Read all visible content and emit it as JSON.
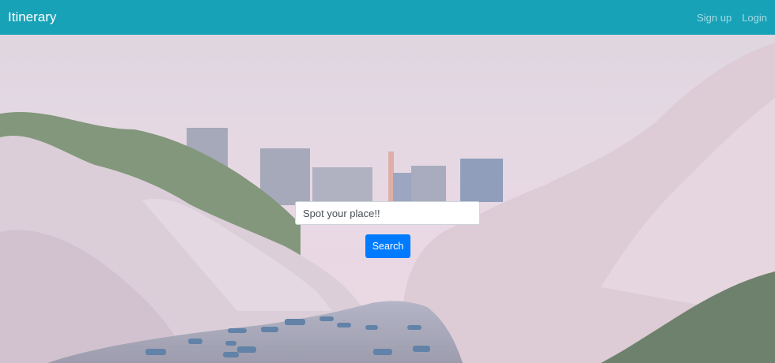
{
  "navbar": {
    "brand": "Itinerary",
    "links": [
      {
        "label": "Sign up"
      },
      {
        "label": "Login"
      }
    ]
  },
  "search": {
    "value": "Spot your place!!",
    "button_label": "Search"
  },
  "colors": {
    "navbar_bg": "#17a2b8",
    "button_bg": "#007bff"
  }
}
